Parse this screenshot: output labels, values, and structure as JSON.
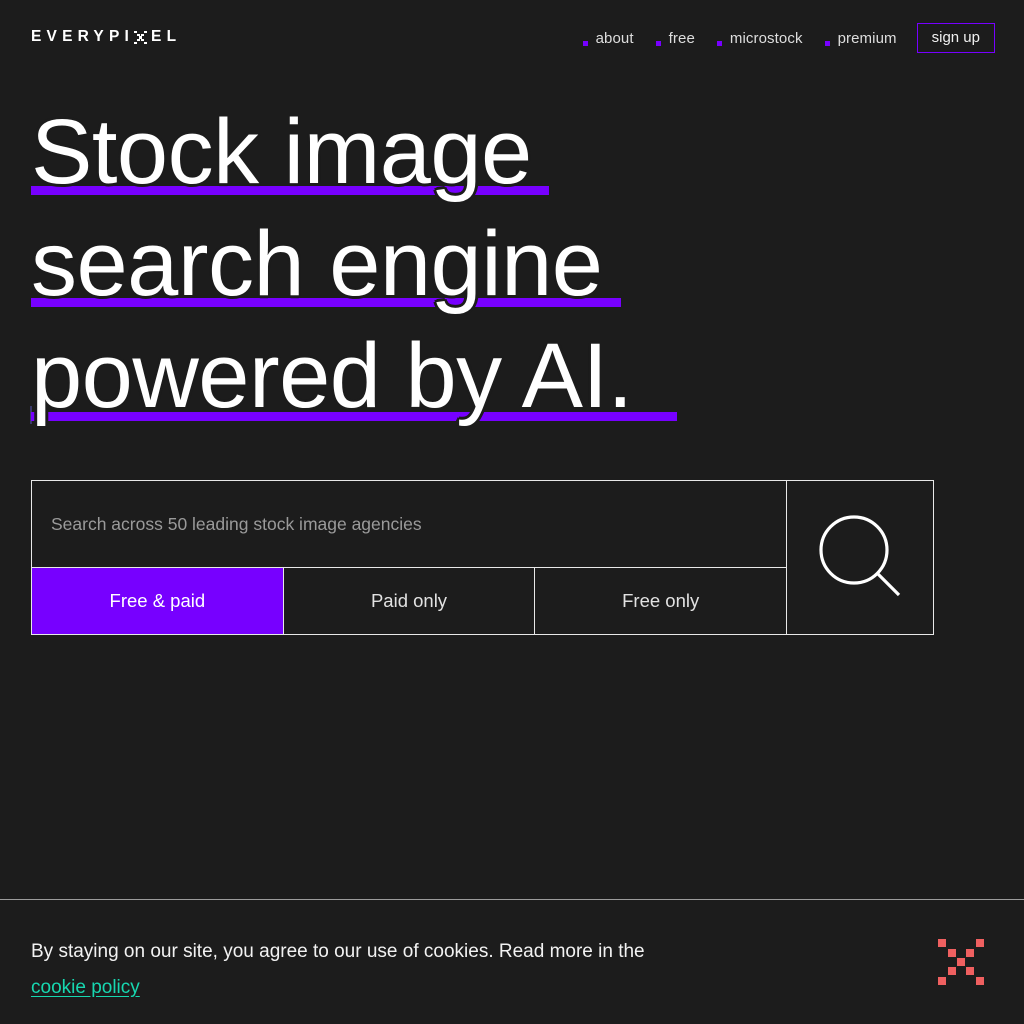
{
  "brand": {
    "name_before": "EVERYPI",
    "name_after": "EL",
    "x_icon": "pixel-x-icon",
    "full_name": "EVERYPIXEL"
  },
  "colors": {
    "background": "#1c1c1c",
    "accent_purple": "#7700ff",
    "link_teal": "#17d7b0",
    "dot_red": "#ef6060",
    "border": "#e8e8e8"
  },
  "nav": {
    "items": [
      {
        "label": "about"
      },
      {
        "label": "free"
      },
      {
        "label": "microstock"
      },
      {
        "label": "premium"
      }
    ],
    "signup_label": "sign up"
  },
  "hero": {
    "line1": "Stock image",
    "line2": "search engine",
    "line3": "powered by AI."
  },
  "search": {
    "placeholder": "Search across 50 leading stock image agencies",
    "value": "",
    "search_icon": "magnifier-icon",
    "tabs": [
      {
        "label": "Free & paid",
        "active": true
      },
      {
        "label": "Paid only",
        "active": false
      },
      {
        "label": "Free only",
        "active": false
      }
    ]
  },
  "cookie": {
    "message": "By staying on our site, you agree to our use of cookies. Read more in the",
    "link_label": "cookie policy",
    "mark_icon": "pixel-x-icon"
  }
}
